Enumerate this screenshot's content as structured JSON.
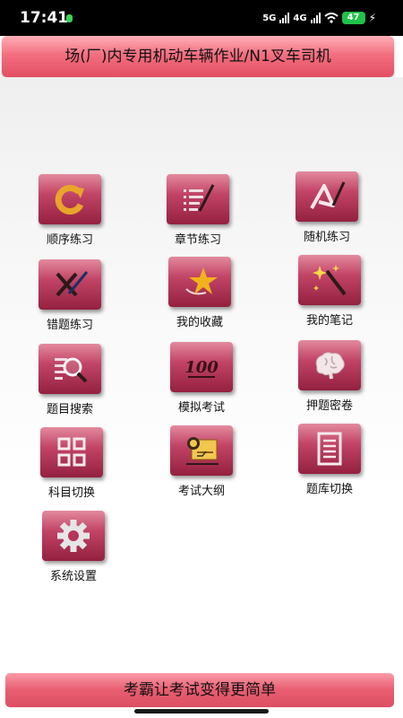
{
  "status_bar": {
    "time": "17:41",
    "network_1": "5G",
    "network_2": "4G",
    "battery": "47"
  },
  "header": {
    "title": "场(厂)内专用机动车辆作业/N1叉车司机"
  },
  "menu": [
    {
      "label": "顺序练习",
      "icon": "refresh-icon"
    },
    {
      "label": "章节练习",
      "icon": "list-pen-icon"
    },
    {
      "label": "随机练习",
      "icon": "random-pen-icon"
    },
    {
      "label": "错题练习",
      "icon": "cross-pen-icon"
    },
    {
      "label": "我的收藏",
      "icon": "star-icon"
    },
    {
      "label": "我的笔记",
      "icon": "magic-wand-icon"
    },
    {
      "label": "题目搜索",
      "icon": "search-icon"
    },
    {
      "label": "模拟考试",
      "icon": "score-100-icon"
    },
    {
      "label": "押题密卷",
      "icon": "brain-icon"
    },
    {
      "label": "科目切换",
      "icon": "grid-icon"
    },
    {
      "label": "考试大纲",
      "icon": "outline-document-icon"
    },
    {
      "label": "题库切换",
      "icon": "document-list-icon"
    },
    {
      "label": "系统设置",
      "icon": "gear-icon"
    }
  ],
  "footer": {
    "slogan": "考霸让考试变得更简单"
  },
  "colors": {
    "accent": "#e24e62",
    "tile": "#b8355a"
  }
}
